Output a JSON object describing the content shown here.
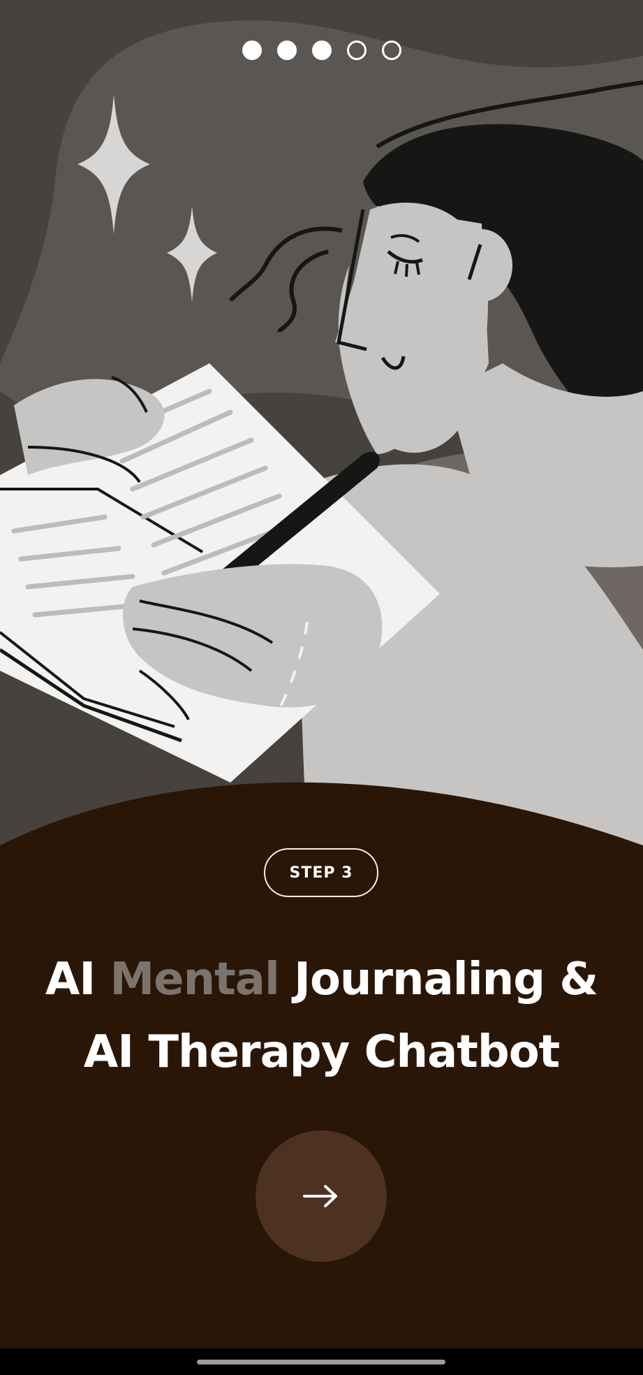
{
  "onboarding": {
    "pagination": {
      "total": 5,
      "current": 3
    },
    "step_label": "STEP 3",
    "headline": {
      "line1_prefix": "AI ",
      "line1_highlight": "Mental",
      "line1_suffix": " Journaling &",
      "line2": "AI Therapy Chatbot"
    },
    "next_button_icon": "arrow-right-icon",
    "illustration_icon": "journaling-woman-illustration"
  },
  "colors": {
    "panel_background": "#2a1607",
    "next_button": "#4d3222",
    "highlight_text": "#7d736d",
    "illustration_background": "#4a4744"
  }
}
